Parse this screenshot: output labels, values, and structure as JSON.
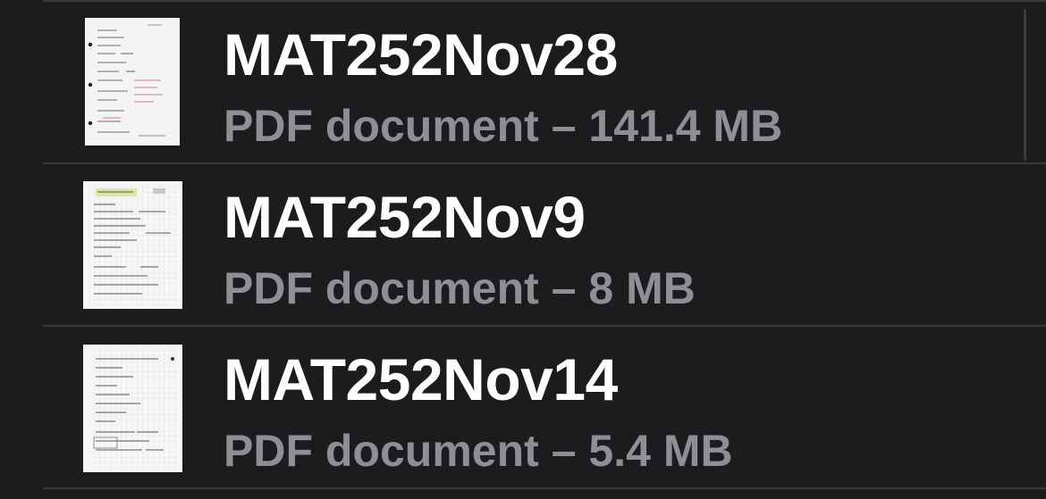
{
  "files": [
    {
      "name": "MAT252Nov28",
      "kind": "PDF document",
      "separator": "–",
      "size": "141.4 MB",
      "thumbnail_icon": "handwritten-notes-thumbnail-icon"
    },
    {
      "name": "MAT252Nov9",
      "kind": "PDF document",
      "separator": "–",
      "size": "8 MB",
      "thumbnail_icon": "handwritten-notes-thumbnail-icon"
    },
    {
      "name": "MAT252Nov14",
      "kind": "PDF document",
      "separator": "–",
      "size": "5.4 MB",
      "thumbnail_icon": "handwritten-notes-thumbnail-icon"
    }
  ],
  "colors": {
    "background": "#1c1c1e",
    "title_text": "#ffffff",
    "subtitle_text": "#8e8e93",
    "divider": "#38383a"
  }
}
